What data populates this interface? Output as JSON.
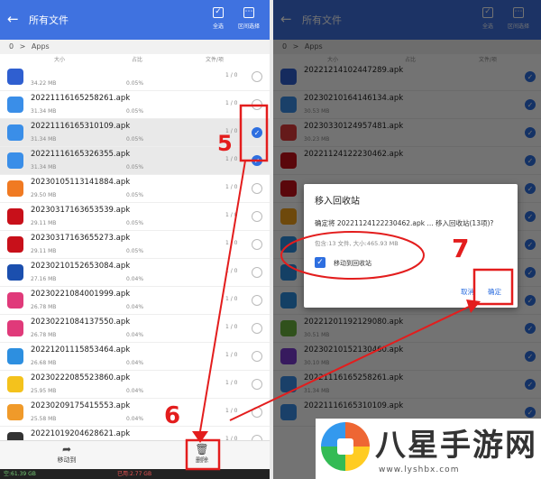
{
  "app_bar": {
    "back_glyph": "←",
    "title": "所有文件",
    "select_all_label": "全选",
    "range_select_label": "区间选择"
  },
  "breadcrumb": {
    "root": "0",
    "separator": ">",
    "folder": "Apps"
  },
  "columns": {
    "size": "大小",
    "ratio": "占比",
    "files": "文件/项"
  },
  "left_rows": [
    {
      "name": "",
      "size": "34.22 MB",
      "pct": "0.05%",
      "count": "1 / 0",
      "checked": false,
      "color": "#2f5fd0"
    },
    {
      "name": "20221116165258261.apk",
      "size": "31.34 MB",
      "pct": "0.05%",
      "count": "1 / 0",
      "checked": false,
      "color": "#3a8ee8"
    },
    {
      "name": "20221116165310109.apk",
      "size": "31.34 MB",
      "pct": "0.05%",
      "count": "1 / 0",
      "checked": true,
      "color": "#3a8ee8"
    },
    {
      "name": "20221116165326355.apk",
      "size": "31.34 MB",
      "pct": "0.05%",
      "count": "1 / 0",
      "checked": true,
      "color": "#3a8ee8"
    },
    {
      "name": "20230105113141884.apk",
      "size": "29.50 MB",
      "pct": "0.05%",
      "count": "1 / 0",
      "checked": false,
      "color": "#f07a22"
    },
    {
      "name": "20230317163653539.apk",
      "size": "29.11 MB",
      "pct": "0.05%",
      "count": "1 / 0",
      "checked": false,
      "color": "#c8101a"
    },
    {
      "name": "20230317163655273.apk",
      "size": "29.11 MB",
      "pct": "0.05%",
      "count": "1 / 0",
      "checked": false,
      "color": "#c8101a"
    },
    {
      "name": "20230210152653084.apk",
      "size": "27.16 MB",
      "pct": "0.04%",
      "count": "1 / 0",
      "checked": false,
      "color": "#1b4fae"
    },
    {
      "name": "20230221084001999.apk",
      "size": "26.78 MB",
      "pct": "0.04%",
      "count": "1 / 0",
      "checked": false,
      "color": "#e03a7a"
    },
    {
      "name": "20230221084137550.apk",
      "size": "26.78 MB",
      "pct": "0.04%",
      "count": "1 / 0",
      "checked": false,
      "color": "#e03a7a"
    },
    {
      "name": "20221201115853464.apk",
      "size": "26.68 MB",
      "pct": "0.04%",
      "count": "1 / 0",
      "checked": false,
      "color": "#2d8fe0"
    },
    {
      "name": "20230222085523860.apk",
      "size": "25.95 MB",
      "pct": "0.04%",
      "count": "1 / 0",
      "checked": false,
      "color": "#f4c21c"
    },
    {
      "name": "20230209175415553.apk",
      "size": "25.58 MB",
      "pct": "0.04%",
      "count": "1 / 0",
      "checked": false,
      "color": "#f09a2a"
    },
    {
      "name": "20221019204628621.apk",
      "size": "25.24 MB",
      "pct": "0.04%",
      "count": "1 / 0",
      "checked": false,
      "color": "#333333"
    }
  ],
  "bottom_bar": {
    "move_icon": "share-arrow-icon",
    "move_label": "移动到",
    "delete_icon": "trash-icon",
    "delete_label": "删除"
  },
  "status_bar": {
    "free": "空:61.39 GB",
    "used": "已用:2.77 GB"
  },
  "right_rows": [
    {
      "name": "20221214102447289.apk",
      "size": "",
      "checked": true,
      "color": "#2f5fd0"
    },
    {
      "name": "20230210164146134.apk",
      "size": "30.53 MB",
      "checked": true,
      "color": "#3a8ee8"
    },
    {
      "name": "20230330124957481.apk",
      "size": "30.23 MB",
      "checked": true,
      "color": "#e03a3a"
    },
    {
      "name": "20221124122230462.apk",
      "size": "",
      "checked": true,
      "color": "#c8101a"
    },
    {
      "name": "",
      "size": "",
      "checked": true,
      "color": "#c8101a"
    },
    {
      "name": "",
      "size": "",
      "checked": true,
      "color": "#f4a21c"
    },
    {
      "name": "",
      "size": "",
      "checked": true,
      "color": "#2d8fe0"
    },
    {
      "name": "",
      "size": "",
      "checked": true,
      "color": "#2d8fe0"
    },
    {
      "name": "",
      "size": "",
      "checked": true,
      "color": "#2d8fe0"
    },
    {
      "name": "20221201192129080.apk",
      "size": "30.51 MB",
      "checked": true,
      "color": "#6cb33e"
    },
    {
      "name": "20230210152130460.apk",
      "size": "30.10 MB",
      "checked": true,
      "color": "#7a3ad0"
    },
    {
      "name": "20221116165258261.apk",
      "size": "31.34 MB",
      "checked": true,
      "color": "#3a8ee8"
    },
    {
      "name": "20221116165310109.apk",
      "size": "",
      "checked": true,
      "color": "#3a8ee8"
    }
  ],
  "dialog": {
    "title": "移入回收站",
    "message": "确定将 20221124122230462.apk ... 移入回收站(13项)?",
    "summary": "包含:13 文件, 大小:465.93 MB",
    "checkbox_label": "移动到回收站",
    "cancel_label": "取消",
    "ok_label": "确定"
  },
  "annotations": {
    "step5": "5",
    "step6": "6",
    "step7": "7",
    "color": "#e31d1d"
  },
  "watermark": {
    "site_name": "八星手游网",
    "url": "www.lyshbx.com"
  }
}
